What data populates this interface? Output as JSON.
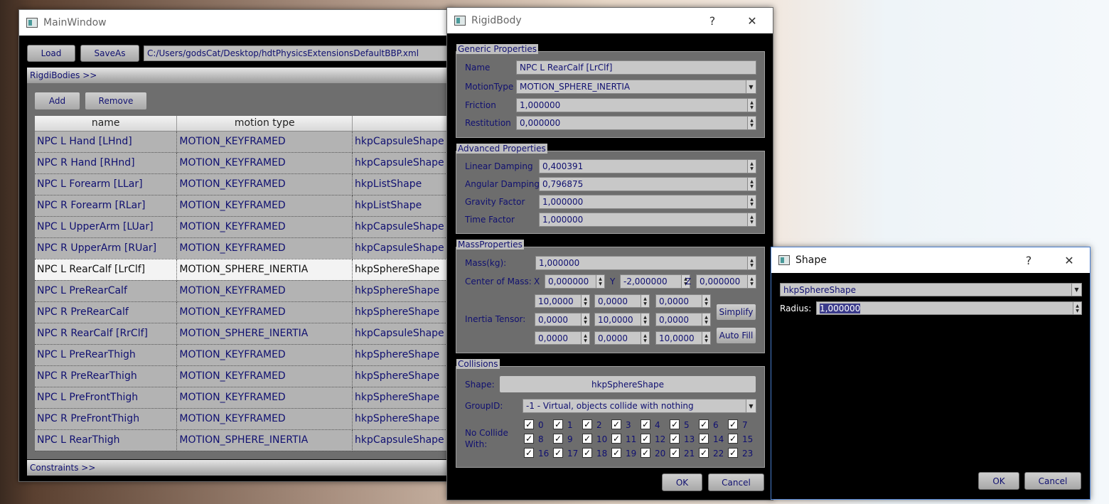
{
  "main_window": {
    "title": "MainWindow",
    "load_label": "Load",
    "saveas_label": "SaveAs",
    "file_path": "C:/Users/godsCat/Desktop/hdtPhysicsExtensionsDefaultBBP.xml",
    "rigidbodies_header": "RigdiBodies >>",
    "add_label": "Add",
    "remove_label": "Remove",
    "columns": [
      "name",
      "motion type",
      ""
    ],
    "rows": [
      [
        "NPC L Hand [LHnd]",
        "MOTION_KEYFRAMED",
        "hkpCapsuleShape"
      ],
      [
        "NPC R Hand [RHnd]",
        "MOTION_KEYFRAMED",
        "hkpCapsuleShape"
      ],
      [
        "NPC L Forearm [LLar]",
        "MOTION_KEYFRAMED",
        "hkpListShape"
      ],
      [
        "NPC R Forearm [RLar]",
        "MOTION_KEYFRAMED",
        "hkpListShape"
      ],
      [
        "NPC L UpperArm [LUar]",
        "MOTION_KEYFRAMED",
        "hkpCapsuleShape"
      ],
      [
        "NPC R UpperArm [RUar]",
        "MOTION_KEYFRAMED",
        "hkpCapsuleShape"
      ],
      [
        "NPC L RearCalf [LrClf]",
        "MOTION_SPHERE_INERTIA",
        "hkpSphereShape"
      ],
      [
        "NPC L PreRearCalf",
        "MOTION_KEYFRAMED",
        "hkpSphereShape"
      ],
      [
        "NPC R PreRearCalf",
        "MOTION_KEYFRAMED",
        "hkpSphereShape"
      ],
      [
        "NPC R RearCalf [RrClf]",
        "MOTION_SPHERE_INERTIA",
        "hkpCapsuleShape"
      ],
      [
        "NPC L PreRearThigh",
        "MOTION_KEYFRAMED",
        "hkpSphereShape"
      ],
      [
        "NPC R PreRearThigh",
        "MOTION_KEYFRAMED",
        "hkpSphereShape"
      ],
      [
        "NPC L PreFrontThigh",
        "MOTION_KEYFRAMED",
        "hkpSphereShape"
      ],
      [
        "NPC R PreFrontThigh",
        "MOTION_KEYFRAMED",
        "hkpSphereShape"
      ],
      [
        "NPC L RearThigh",
        "MOTION_SPHERE_INERTIA",
        "hkpCapsuleShape"
      ]
    ],
    "constraints_header": "Constraints >>"
  },
  "rigidbody": {
    "title": "RigidBody",
    "help": "?",
    "close": "✕",
    "generic_title": "Generic Properties",
    "name_label": "Name",
    "name_value": "NPC L RearCalf [LrClf]",
    "motiontype_label": "MotionType",
    "motiontype_value": "MOTION_SPHERE_INERTIA",
    "friction_label": "Friction",
    "friction_value": "1,000000",
    "restitution_label": "Restitution",
    "restitution_value": "0,000000",
    "advanced_title": "Advanced Properties",
    "linear_damping_label": "Linear Damping",
    "linear_damping_value": "0,400391",
    "angular_damping_label": "Angular Damping",
    "angular_damping_value": "0,796875",
    "gravity_label": "Gravity Factor",
    "gravity_value": "1,000000",
    "time_label": "Time Factor",
    "time_value": "1,000000",
    "mass_title": "MassProperties",
    "mass_label": "Mass(kg):",
    "mass_value": "1,000000",
    "com_label": "Center of Mass:",
    "x_label": "X",
    "y_label": "Y",
    "z_label": "Z",
    "com_x": "0,000000",
    "com_y": "-2,000000",
    "com_z": "0,000000",
    "inertia_label": "Inertia Tensor:",
    "inertia": [
      [
        "10,0000",
        "0,0000",
        "0,0000"
      ],
      [
        "0,0000",
        "10,0000",
        "0,0000"
      ],
      [
        "0,0000",
        "0,0000",
        "10,0000"
      ]
    ],
    "simplify_label": "Simplify",
    "autofill_label": "Auto Fill",
    "collisions_title": "Collisions",
    "shape_label": "Shape:",
    "shape_value": "hkpSphereShape",
    "groupid_label": "GroupID:",
    "groupid_value": "-1 - Virtual, objects collide with nothing",
    "nocollide_label_1": "No Collide",
    "nocollide_label_2": "With:",
    "nocollide": [
      "0",
      "1",
      "2",
      "3",
      "4",
      "5",
      "6",
      "7",
      "8",
      "9",
      "10",
      "11",
      "12",
      "13",
      "14",
      "15",
      "16",
      "17",
      "18",
      "19",
      "20",
      "21",
      "22",
      "23"
    ],
    "ok_label": "OK",
    "cancel_label": "Cancel"
  },
  "shape": {
    "title": "Shape",
    "help": "?",
    "close": "✕",
    "shape_type": "hkpSphereShape",
    "radius_label": "Radius:",
    "radius_value": "1,000000",
    "ok_label": "OK",
    "cancel_label": "Cancel"
  }
}
